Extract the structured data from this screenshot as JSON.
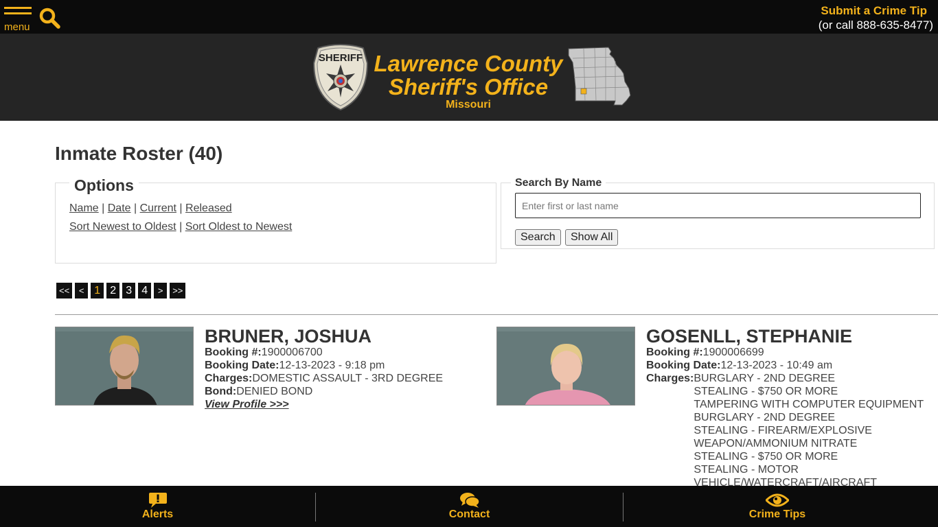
{
  "topbar": {
    "menu_label": "menu",
    "tip_link": "Submit a Crime Tip",
    "tip_phone": "(or call 888-635-8477)"
  },
  "banner": {
    "title_line1": "Lawrence County",
    "title_line2": "Sheriff's Office",
    "state": "Missouri",
    "badge_text": "SHERIFF"
  },
  "main": {
    "page_title": "Inmate Roster (40)",
    "options": {
      "legend": "Options",
      "sort_links": [
        "Name",
        "Date",
        "Current",
        "Released"
      ],
      "order_links": [
        "Sort Newest to Oldest",
        "Sort Oldest to Newest"
      ]
    },
    "search": {
      "legend": "Search By Name",
      "placeholder": "Enter first or last name",
      "search_button": "Search",
      "show_all_button": "Show All"
    },
    "pagination": {
      "first": "<<",
      "prev": "<",
      "pages": [
        "1",
        "2",
        "3",
        "4"
      ],
      "current": "1",
      "next": ">",
      "last": ">>"
    }
  },
  "inmates": [
    {
      "name": "BRUNER, JOSHUA",
      "booking_label": "Booking #:",
      "booking_number": "1900006700",
      "date_label": "Booking Date:",
      "booking_date": "12-13-2023 - 9:18 pm",
      "charges_label": "Charges:",
      "charges": [
        "DOMESTIC ASSAULT - 3RD DEGREE"
      ],
      "bond_label": "Bond:",
      "bond": "DENIED BOND",
      "profile_link": "View Profile >>>"
    },
    {
      "name": "GOSENLL, STEPHANIE",
      "booking_label": "Booking #:",
      "booking_number": "1900006699",
      "date_label": "Booking Date:",
      "booking_date": "12-13-2023 - 10:49 am",
      "charges_label": "Charges:",
      "charges": [
        "BURGLARY - 2ND DEGREE",
        "STEALING - $750 OR MORE",
        "TAMPERING WITH COMPUTER EQUIPMENT",
        "BURGLARY - 2ND DEGREE",
        "STEALING - FIREARM/EXPLOSIVE",
        "WEAPON/AMMONIUM NITRATE",
        "STEALING - $750 OR MORE",
        "STEALING - MOTOR",
        "VEHICLE/WATERCRAFT/AIRCRAFT"
      ]
    }
  ],
  "bottombar": {
    "alerts": "Alerts",
    "contact": "Contact",
    "crime_tips": "Crime Tips"
  },
  "colors": {
    "accent_gold": "#f3b21b",
    "bar_black": "#0b0b0b",
    "banner_dark": "#252525"
  },
  "icons": [
    "menu-icon",
    "search-icon",
    "sheriff-badge",
    "missouri-map",
    "alert-bubble-icon",
    "chat-bubbles-icon",
    "eye-icon"
  ]
}
